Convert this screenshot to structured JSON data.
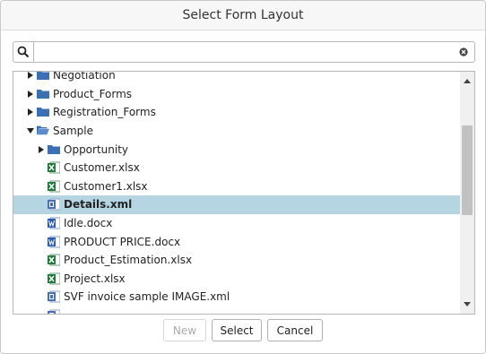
{
  "dialog": {
    "title": "Select Form Layout"
  },
  "search": {
    "value": "",
    "placeholder": ""
  },
  "tree": {
    "items": [
      {
        "label": "Negotiation",
        "type": "folder",
        "level": 0,
        "toggle": "collapsed"
      },
      {
        "label": "Product_Forms",
        "type": "folder",
        "level": 0,
        "toggle": "collapsed"
      },
      {
        "label": "Registration_Forms",
        "type": "folder",
        "level": 0,
        "toggle": "collapsed"
      },
      {
        "label": "Sample",
        "type": "folder-open",
        "level": 0,
        "toggle": "expanded"
      },
      {
        "label": "Opportunity",
        "type": "folder",
        "level": 1,
        "toggle": "collapsed"
      },
      {
        "label": "Customer.xlsx",
        "type": "excel",
        "level": 1,
        "toggle": "none"
      },
      {
        "label": "Customer1.xlsx",
        "type": "excel",
        "level": 1,
        "toggle": "none"
      },
      {
        "label": "Details.xml",
        "type": "xml",
        "level": 1,
        "toggle": "none",
        "selected": true
      },
      {
        "label": "Idle.docx",
        "type": "word",
        "level": 1,
        "toggle": "none"
      },
      {
        "label": "PRODUCT PRICE.docx",
        "type": "word",
        "level": 1,
        "toggle": "none"
      },
      {
        "label": "Product_Estimation.xlsx",
        "type": "excel",
        "level": 1,
        "toggle": "none"
      },
      {
        "label": "Project.xlsx",
        "type": "excel",
        "level": 1,
        "toggle": "none"
      },
      {
        "label": "SVF invoice sample IMAGE.xml",
        "type": "xml",
        "level": 1,
        "toggle": "none"
      },
      {
        "label": "",
        "type": "xml",
        "level": 1,
        "toggle": "none"
      }
    ]
  },
  "buttons": {
    "new": "New",
    "select": "Select",
    "cancel": "Cancel"
  },
  "colors": {
    "selection": "#b5d5e3",
    "folder": "#3b6fb6",
    "excel": "#1f7a3a",
    "word": "#2b5cad",
    "xml": "#4a6fb3"
  }
}
